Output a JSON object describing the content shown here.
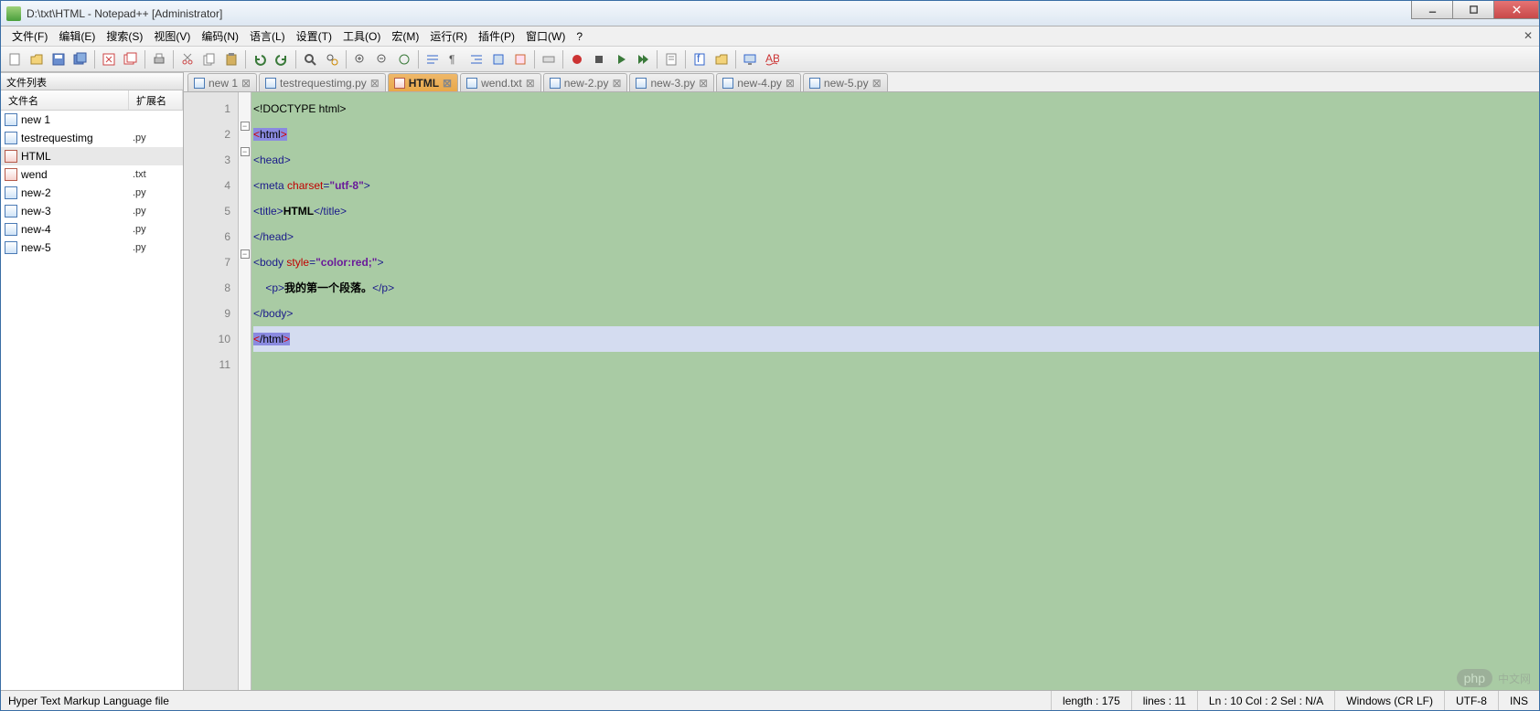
{
  "title": "D:\\txt\\HTML - Notepad++ [Administrator]",
  "menus": [
    "文件(F)",
    "编辑(E)",
    "搜索(S)",
    "视图(V)",
    "编码(N)",
    "语言(L)",
    "设置(T)",
    "工具(O)",
    "宏(M)",
    "运行(R)",
    "插件(P)",
    "窗口(W)",
    "?"
  ],
  "sidebar": {
    "title": "文件列表",
    "col1": "文件名",
    "col2": "扩展名",
    "items": [
      {
        "name": "new 1",
        "ext": "",
        "icon": "blue"
      },
      {
        "name": "testrequestimg",
        "ext": ".py",
        "icon": "blue"
      },
      {
        "name": "HTML",
        "ext": "",
        "icon": "red",
        "active": true
      },
      {
        "name": "wend",
        "ext": ".txt",
        "icon": "red"
      },
      {
        "name": "new-2",
        "ext": ".py",
        "icon": "blue"
      },
      {
        "name": "new-3",
        "ext": ".py",
        "icon": "blue"
      },
      {
        "name": "new-4",
        "ext": ".py",
        "icon": "blue"
      },
      {
        "name": "new-5",
        "ext": ".py",
        "icon": "blue"
      }
    ]
  },
  "tabs": [
    {
      "label": "new 1",
      "icon": "blue"
    },
    {
      "label": "testrequestimg.py",
      "icon": "blue"
    },
    {
      "label": "HTML",
      "icon": "red",
      "active": true
    },
    {
      "label": "wend.txt",
      "icon": "blue"
    },
    {
      "label": "new-2.py",
      "icon": "blue"
    },
    {
      "label": "new-3.py",
      "icon": "blue"
    },
    {
      "label": "new-4.py",
      "icon": "blue"
    },
    {
      "label": "new-5.py",
      "icon": "blue"
    }
  ],
  "code": {
    "line_count": 11,
    "lines": [
      {
        "n": 1,
        "seg": [
          {
            "t": "<!DOCTYPE html>",
            "c": "c-norm"
          }
        ]
      },
      {
        "n": 2,
        "fold": "open",
        "seg": [
          {
            "t": "<",
            "c": "hl-red"
          },
          {
            "t": "html",
            "c": "hl-tag"
          },
          {
            "t": ">",
            "c": "hl-red"
          }
        ]
      },
      {
        "n": 3,
        "fold": "open",
        "seg": [
          {
            "t": "<head>",
            "c": "c-tag"
          }
        ]
      },
      {
        "n": 4,
        "seg": [
          {
            "t": "<meta ",
            "c": "c-tag"
          },
          {
            "t": "charset",
            "c": "c-attr"
          },
          {
            "t": "=",
            "c": "c-tag"
          },
          {
            "t": "\"utf-8\"",
            "c": "c-str"
          },
          {
            "t": ">",
            "c": "c-tag"
          }
        ]
      },
      {
        "n": 5,
        "seg": [
          {
            "t": "<title>",
            "c": "c-tag"
          },
          {
            "t": "HTML",
            "c": "c-text"
          },
          {
            "t": "</title>",
            "c": "c-tag"
          }
        ]
      },
      {
        "n": 6,
        "seg": [
          {
            "t": "</head>",
            "c": "c-tag"
          }
        ]
      },
      {
        "n": 7,
        "fold": "open",
        "seg": [
          {
            "t": "<body ",
            "c": "c-tag"
          },
          {
            "t": "style",
            "c": "c-attr"
          },
          {
            "t": "=",
            "c": "c-tag"
          },
          {
            "t": "\"color:red;\"",
            "c": "c-str"
          },
          {
            "t": ">",
            "c": "c-tag"
          }
        ]
      },
      {
        "n": 8,
        "seg": [
          {
            "t": "    ",
            "c": "c-norm"
          },
          {
            "t": "<p>",
            "c": "c-tag"
          },
          {
            "t": "我的第一个段落。",
            "c": "c-text"
          },
          {
            "t": "</p>",
            "c": "c-tag"
          }
        ]
      },
      {
        "n": 9,
        "seg": [
          {
            "t": "</body>",
            "c": "c-tag"
          }
        ]
      },
      {
        "n": 10,
        "hl": true,
        "seg": [
          {
            "t": "<",
            "c": "hl-red"
          },
          {
            "t": "/html",
            "c": "hl-tag"
          },
          {
            "t": ">",
            "c": "hl-red"
          }
        ]
      },
      {
        "n": 11,
        "seg": []
      }
    ]
  },
  "status": {
    "filetype": "Hyper Text Markup Language file",
    "length": "length : 175",
    "lines": "lines : 11",
    "pos": "Ln : 10    Col : 2    Sel : N/A",
    "eol": "Windows (CR LF)",
    "enc": "UTF-8",
    "ins": "INS"
  },
  "watermark": {
    "badge": "php",
    "text": "中文网"
  }
}
